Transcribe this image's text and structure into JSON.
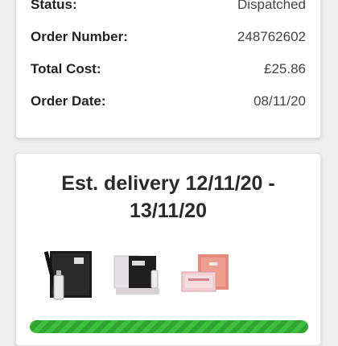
{
  "order_details": {
    "status_label": "Status:",
    "status_value": "Dispatched",
    "order_number_label": "Order Number:",
    "order_number_value": "248762602",
    "total_cost_label": "Total Cost:",
    "total_cost_value": "£25.86",
    "order_date_label": "Order Date:",
    "order_date_value": "08/11/20"
  },
  "delivery": {
    "title_line1": "Est. delivery 12/11/20 -",
    "title_line2": "13/11/20",
    "progress_percent": 100,
    "progress_color": "#3fbf3f"
  },
  "products": [
    {
      "icon": "product-black-box-with-bottle-icon"
    },
    {
      "icon": "product-grey-gift-set-icon"
    },
    {
      "icon": "product-pink-gift-set-icon"
    }
  ]
}
